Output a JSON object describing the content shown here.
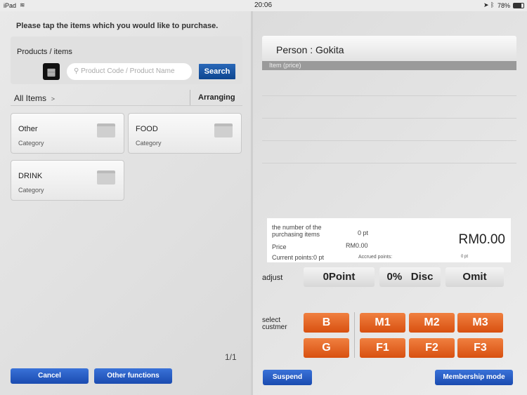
{
  "status": {
    "device": "iPad",
    "time": "20:06",
    "battery": "78%"
  },
  "left": {
    "instruction": "Please tap the items which you would like to purchase.",
    "panel_title": "Products / items",
    "search_placeholder": "Product Code / Product Name",
    "search_label": "Search",
    "breadcrumb": "All Items",
    "breadcrumb_arrow": ">",
    "arranging": "Arranging",
    "categories": [
      {
        "name": "Other",
        "type": "Category"
      },
      {
        "name": "FOOD",
        "type": "Category"
      },
      {
        "name": "DRINK",
        "type": "Category"
      }
    ],
    "page": "1/1",
    "cancel": "Cancel",
    "other_functions": "Other functions"
  },
  "right": {
    "person": "Person : Gokita",
    "column_header": "Item (price)",
    "summary": {
      "count_label": "the number of the purchasing items",
      "count_value": "0 pt",
      "price_label": "Price",
      "price_value": "RM0.00",
      "total": "RM0.00",
      "current_points": "Current points:0 pt",
      "accrued_label": "Accrued points:",
      "accrued_value": "0 pt"
    },
    "adjust_label": "adjust",
    "point_btn": "0Point",
    "disc_pct": "0%",
    "disc_btn": "Disc",
    "omit_btn": "Omit",
    "select_label": "select custmer",
    "customer_buttons": [
      "B",
      "G",
      "M1",
      "M2",
      "M3",
      "F1",
      "F2",
      "F3"
    ],
    "suspend": "Suspend",
    "membership": "Membership mode"
  },
  "colors": {
    "accent_blue": "#1a4bb0",
    "accent_orange": "#e06020"
  }
}
